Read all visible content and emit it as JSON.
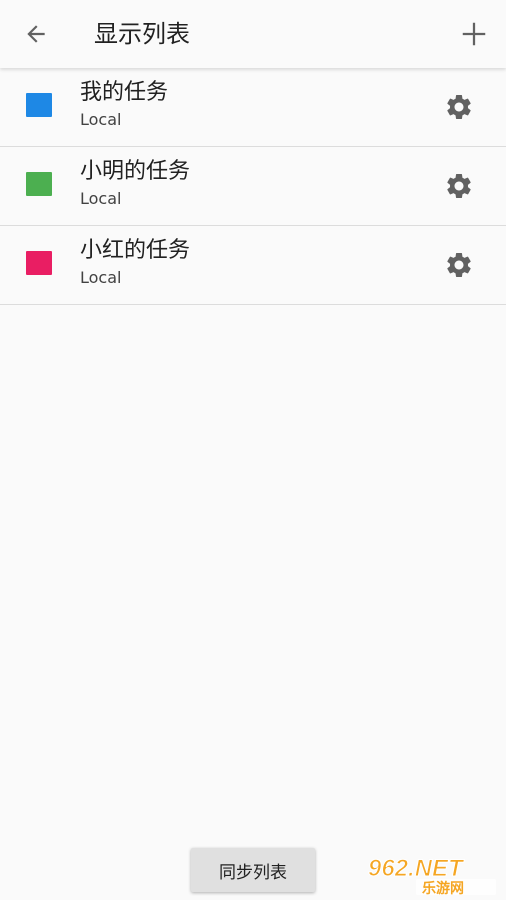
{
  "toolbar": {
    "title": "显示列表",
    "back_icon": "arrow-left-icon",
    "add_icon": "plus-icon"
  },
  "lists": [
    {
      "name": "我的任务",
      "account": "Local",
      "color": "#1e88e5",
      "icon": "gear-icon"
    },
    {
      "name": "小明的任务",
      "account": "Local",
      "color": "#4caf50",
      "icon": "gear-icon"
    },
    {
      "name": "小红的任务",
      "account": "Local",
      "color": "#e91e63",
      "icon": "gear-icon"
    }
  ],
  "footer": {
    "sync_label": "同步列表"
  },
  "watermark": {
    "brand": "962.NET",
    "sub": "乐游网"
  },
  "colors": {
    "background": "#fafafa",
    "divider": "#dcdcdc",
    "icon": "#616161",
    "watermark_orange": "#f5a623"
  }
}
